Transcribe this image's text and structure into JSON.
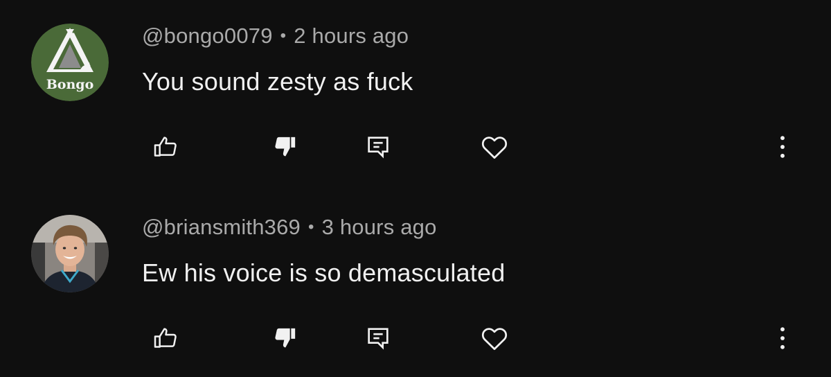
{
  "comments": [
    {
      "author": "@bongo0079",
      "separator": "•",
      "time": "2 hours ago",
      "text": "You sound zesty as fuck",
      "avatar_label": "Bongo",
      "avatar_color": "#4a6a38"
    },
    {
      "author": "@briansmith369",
      "separator": "•",
      "time": "3 hours ago",
      "text": "Ew his voice is so demasculated",
      "avatar_color": "#8a8580"
    }
  ],
  "icons": {
    "like": "thumbs-up-icon",
    "dislike": "thumbs-down-icon",
    "reply": "reply-icon",
    "heart": "heart-icon",
    "more": "more-vertical-icon"
  },
  "colors": {
    "background": "#0f0f0f",
    "meta_text": "#aaaaaa",
    "body_text": "#f1f1f1"
  }
}
